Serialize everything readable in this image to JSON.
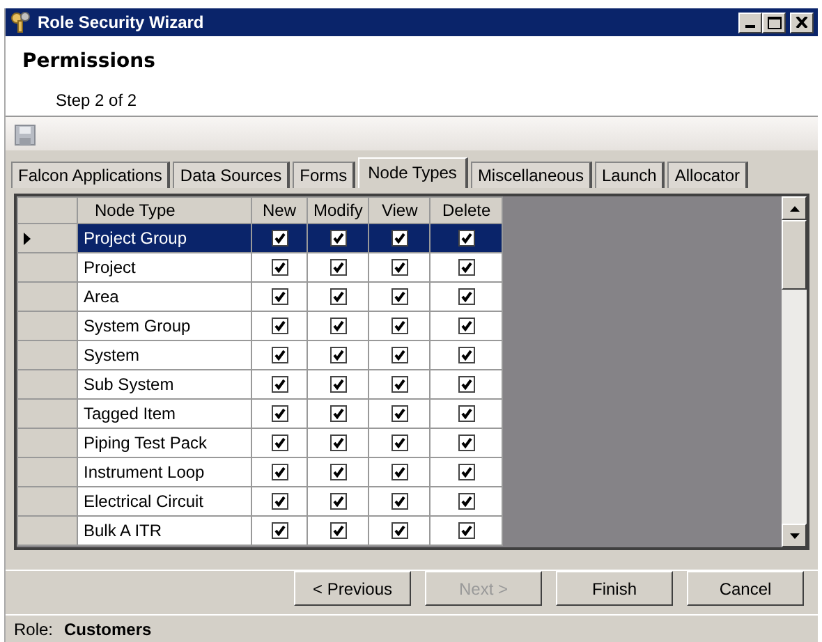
{
  "window": {
    "title": "Role Security Wizard"
  },
  "header": {
    "title": "Permissions",
    "subtitle": "Step 2 of 2"
  },
  "tabs": [
    {
      "label": "Falcon Applications",
      "selected": false
    },
    {
      "label": "Data Sources",
      "selected": false
    },
    {
      "label": "Forms",
      "selected": false
    },
    {
      "label": "Node Types",
      "selected": true
    },
    {
      "label": "Miscellaneous",
      "selected": false
    },
    {
      "label": "Launch",
      "selected": false
    },
    {
      "label": "Allocator",
      "selected": false
    }
  ],
  "grid": {
    "columns": [
      "Node Type",
      "New",
      "Modify",
      "View",
      "Delete"
    ],
    "rows": [
      {
        "name": "Project Group",
        "selected": true,
        "checks": [
          true,
          true,
          true,
          true
        ]
      },
      {
        "name": "Project",
        "selected": false,
        "checks": [
          true,
          true,
          true,
          true
        ]
      },
      {
        "name": "Area",
        "selected": false,
        "checks": [
          true,
          true,
          true,
          true
        ]
      },
      {
        "name": "System Group",
        "selected": false,
        "checks": [
          true,
          true,
          true,
          true
        ]
      },
      {
        "name": "System",
        "selected": false,
        "checks": [
          true,
          true,
          true,
          true
        ]
      },
      {
        "name": "Sub System",
        "selected": false,
        "checks": [
          true,
          true,
          true,
          true
        ]
      },
      {
        "name": "Tagged Item",
        "selected": false,
        "checks": [
          true,
          true,
          true,
          true
        ]
      },
      {
        "name": "Piping Test Pack",
        "selected": false,
        "checks": [
          true,
          true,
          true,
          true
        ]
      },
      {
        "name": "Instrument Loop",
        "selected": false,
        "checks": [
          true,
          true,
          true,
          true
        ]
      },
      {
        "name": "Electrical Circuit",
        "selected": false,
        "checks": [
          true,
          true,
          true,
          true
        ]
      },
      {
        "name": "Bulk A ITR",
        "selected": false,
        "checks": [
          true,
          true,
          true,
          true
        ]
      }
    ]
  },
  "buttons": [
    {
      "label": "< Previous",
      "disabled": false
    },
    {
      "label": "Next >",
      "disabled": true
    },
    {
      "label": "Finish",
      "disabled": false
    },
    {
      "label": "Cancel",
      "disabled": false
    }
  ],
  "status_bar": {
    "label": "Role:",
    "value": "Customers"
  }
}
